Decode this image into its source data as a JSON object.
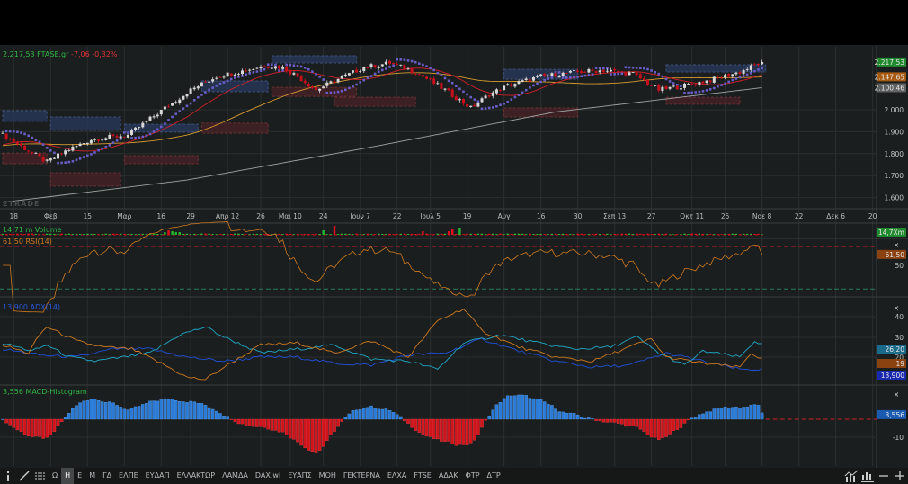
{
  "header": {
    "price": "2.217,53",
    "symbol": "FTASE.gr",
    "change": "-7,06",
    "change_pct": "-0,32%"
  },
  "watermark": "2TRADE",
  "panels": {
    "volume": {
      "label": "14,71 m Volume",
      "tag": "14,7Xm"
    },
    "rsi": {
      "label": "61,50 RSI(14)",
      "tag": "61,50",
      "ticks": [
        "50"
      ]
    },
    "adx": {
      "label": "13,900 ADX(14)",
      "tags": [
        "26,20",
        "19",
        "13,900"
      ],
      "ticks": [
        "40",
        "30",
        "20"
      ]
    },
    "macd": {
      "label": "3,556 MACD-Histogram",
      "tag": "3,556",
      "ticks": [
        "-10"
      ]
    }
  },
  "price_axis": {
    "ticks": [
      {
        "v": 2000,
        "t": "2.000"
      },
      {
        "v": 1900,
        "t": "1.900"
      },
      {
        "v": 1800,
        "t": "1.800"
      },
      {
        "v": 1700,
        "t": "1.700"
      },
      {
        "v": 1600,
        "t": "1.600"
      }
    ],
    "tags": [
      {
        "t": "2.217,53",
        "v": 2217.53,
        "color": "#1f8a2e"
      },
      {
        "t": "2.147,65",
        "v": 2150,
        "color": "#a85a10"
      },
      {
        "t": "2.100,46",
        "v": 2100.46,
        "color": "#5d6060"
      }
    ]
  },
  "x_axis": [
    {
      "t": "18",
      "i": 3
    },
    {
      "t": "Φεβ",
      "i": 13
    },
    {
      "t": "15",
      "i": 23
    },
    {
      "t": "Μαρ",
      "i": 33
    },
    {
      "t": "16",
      "i": 43
    },
    {
      "t": "29",
      "i": 51
    },
    {
      "t": "Απρ 12",
      "i": 61
    },
    {
      "t": "26",
      "i": 70
    },
    {
      "t": "Μαι 10",
      "i": 78
    },
    {
      "t": "24",
      "i": 87
    },
    {
      "t": "Ιουν 7",
      "i": 97
    },
    {
      "t": "22",
      "i": 107
    },
    {
      "t": "Ιουλ 5",
      "i": 116
    },
    {
      "t": "19",
      "i": 126
    },
    {
      "t": "Αυγ",
      "i": 136
    },
    {
      "t": "16",
      "i": 146
    },
    {
      "t": "30",
      "i": 156
    },
    {
      "t": "Σεπ 13",
      "i": 166
    },
    {
      "t": "27",
      "i": 176
    },
    {
      "t": "Οκτ 11",
      "i": 187
    },
    {
      "t": "25",
      "i": 196
    },
    {
      "t": "Νοε 8",
      "i": 206
    },
    {
      "t": "22",
      "i": 216
    },
    {
      "t": "Δεκ 6",
      "i": 226
    },
    {
      "t": "20",
      "i": 236
    }
  ],
  "toolbar": {
    "items": [
      "Ω",
      "Η",
      "Ε",
      "Μ",
      "ΓΔ",
      "ΕΛΠΕ",
      "ΕΥΔΑΠ",
      "ΕΛΛΑΚΤΩΡ",
      "ΛΑΜΔΑ",
      "DAX.wi",
      "ΕΥΑΠΣ",
      "ΜΟΗ",
      "ΓΕΚΤΕΡΝΑ",
      "ΕΛΧΑ",
      "FTSE",
      "ΑΔΑΚ",
      "ΦΤΡ",
      "ΔΤΡ"
    ],
    "active": "Η"
  },
  "colors": {
    "up": "#d8d8d8",
    "down": "#c8101c",
    "ma20": "#d0202a",
    "ma50": "#d89a30",
    "ma200": "#a0a4a4",
    "psar": "#6a5cc8",
    "rsi": "#d07a20",
    "adx": "#2050d8",
    "pdi": "#20a8c8",
    "mdi": "#d07a20",
    "macd_pos": "#2a7ad8",
    "macd_neg": "#d0141c"
  },
  "chart_data": {
    "type": "candlestick",
    "title": "FTASE.gr",
    "days": 207,
    "close_anchors": [
      [
        0,
        1885
      ],
      [
        12,
        1762
      ],
      [
        17,
        1811
      ],
      [
        24,
        1865
      ],
      [
        34,
        1885
      ],
      [
        44,
        2008
      ],
      [
        51,
        2090
      ],
      [
        58,
        2152
      ],
      [
        66,
        2180
      ],
      [
        71,
        2201
      ],
      [
        76,
        2193
      ],
      [
        80,
        2152
      ],
      [
        85,
        2090
      ],
      [
        90,
        2131
      ],
      [
        98,
        2193
      ],
      [
        105,
        2213
      ],
      [
        112,
        2172
      ],
      [
        120,
        2090
      ],
      [
        127,
        2008
      ],
      [
        132,
        2070
      ],
      [
        137,
        2110
      ],
      [
        146,
        2152
      ],
      [
        156,
        2172
      ],
      [
        163,
        2180
      ],
      [
        171,
        2164
      ],
      [
        178,
        2090
      ],
      [
        185,
        2110
      ],
      [
        193,
        2139
      ],
      [
        200,
        2172
      ],
      [
        206,
        2217.53
      ]
    ],
    "ma200_anchors": [
      [
        0,
        1578
      ],
      [
        50,
        1680
      ],
      [
        100,
        1830
      ],
      [
        150,
        1990
      ],
      [
        206,
        2100.46
      ]
    ],
    "zones": [
      {
        "type": "supply",
        "from": 0,
        "to": 12,
        "low": 1947,
        "high": 1996
      },
      {
        "type": "supply",
        "from": 13,
        "to": 32,
        "low": 1906,
        "high": 1967
      },
      {
        "type": "supply",
        "from": 33,
        "to": 53,
        "low": 1898,
        "high": 1934
      },
      {
        "type": "supply",
        "from": 54,
        "to": 72,
        "low": 2082,
        "high": 2131
      },
      {
        "type": "supply",
        "from": 73,
        "to": 96,
        "low": 2213,
        "high": 2246
      },
      {
        "type": "supply",
        "from": 136,
        "to": 156,
        "low": 2139,
        "high": 2184
      },
      {
        "type": "supply",
        "from": 180,
        "to": 207,
        "low": 2172,
        "high": 2205
      },
      {
        "type": "demand",
        "from": 0,
        "to": 12,
        "low": 1754,
        "high": 1803
      },
      {
        "type": "demand",
        "from": 13,
        "to": 32,
        "low": 1652,
        "high": 1713
      },
      {
        "type": "demand",
        "from": 33,
        "to": 53,
        "low": 1754,
        "high": 1791
      },
      {
        "type": "demand",
        "from": 54,
        "to": 72,
        "low": 1893,
        "high": 1939
      },
      {
        "type": "demand",
        "from": 73,
        "to": 96,
        "low": 2061,
        "high": 2102
      },
      {
        "type": "demand",
        "from": 90,
        "to": 112,
        "low": 2016,
        "high": 2057
      },
      {
        "type": "demand",
        "from": 136,
        "to": 156,
        "low": 1967,
        "high": 2008
      },
      {
        "type": "demand",
        "from": 180,
        "to": 200,
        "low": 2025,
        "high": 2057
      }
    ],
    "volume_spikes": [
      [
        44,
        3
      ],
      [
        45,
        5
      ],
      [
        46,
        4
      ],
      [
        47,
        3
      ],
      [
        48,
        3
      ],
      [
        87,
        5
      ],
      [
        114,
        4
      ],
      [
        121,
        4
      ],
      [
        122,
        6
      ],
      [
        90,
        10
      ],
      [
        124,
        8
      ]
    ],
    "adx": {
      "adx": [
        [
          0,
          24
        ],
        [
          10,
          21
        ],
        [
          20,
          20
        ],
        [
          30,
          24
        ],
        [
          40,
          24
        ],
        [
          50,
          20
        ],
        [
          60,
          18
        ],
        [
          70,
          20
        ],
        [
          80,
          20
        ],
        [
          90,
          17
        ],
        [
          100,
          16
        ],
        [
          110,
          21
        ],
        [
          120,
          22
        ],
        [
          130,
          29
        ],
        [
          140,
          23
        ],
        [
          150,
          18
        ],
        [
          160,
          15
        ],
        [
          170,
          16
        ],
        [
          180,
          22
        ],
        [
          190,
          18
        ],
        [
          200,
          14
        ],
        [
          206,
          13.9
        ]
      ],
      "plus_di": [
        [
          0,
          27
        ],
        [
          8,
          23
        ],
        [
          12,
          26
        ],
        [
          18,
          20
        ],
        [
          25,
          18
        ],
        [
          33,
          20
        ],
        [
          40,
          22
        ],
        [
          48,
          31
        ],
        [
          55,
          35
        ],
        [
          60,
          30
        ],
        [
          70,
          22
        ],
        [
          80,
          24
        ],
        [
          90,
          26
        ],
        [
          100,
          19
        ],
        [
          110,
          18
        ],
        [
          118,
          14
        ],
        [
          125,
          27
        ],
        [
          135,
          31
        ],
        [
          145,
          27
        ],
        [
          155,
          24
        ],
        [
          165,
          25
        ],
        [
          172,
          30
        ],
        [
          178,
          22
        ],
        [
          185,
          16
        ],
        [
          190,
          23
        ],
        [
          200,
          20
        ],
        [
          204,
          28
        ],
        [
          206,
          26.2
        ]
      ],
      "minus_di": [
        [
          0,
          26
        ],
        [
          7,
          22
        ],
        [
          10,
          31
        ],
        [
          12,
          35
        ],
        [
          20,
          28
        ],
        [
          27,
          25
        ],
        [
          35,
          24
        ],
        [
          44,
          16
        ],
        [
          50,
          10
        ],
        [
          55,
          9
        ],
        [
          60,
          15
        ],
        [
          70,
          26
        ],
        [
          80,
          27
        ],
        [
          90,
          22
        ],
        [
          100,
          28
        ],
        [
          110,
          20
        ],
        [
          118,
          38
        ],
        [
          125,
          44
        ],
        [
          130,
          33
        ],
        [
          140,
          25
        ],
        [
          150,
          20
        ],
        [
          160,
          18
        ],
        [
          170,
          25
        ],
        [
          176,
          29
        ],
        [
          180,
          20
        ],
        [
          190,
          17
        ],
        [
          200,
          15
        ],
        [
          203,
          22
        ],
        [
          206,
          19
        ]
      ]
    },
    "rsi_levels": [
      70,
      30
    ]
  }
}
